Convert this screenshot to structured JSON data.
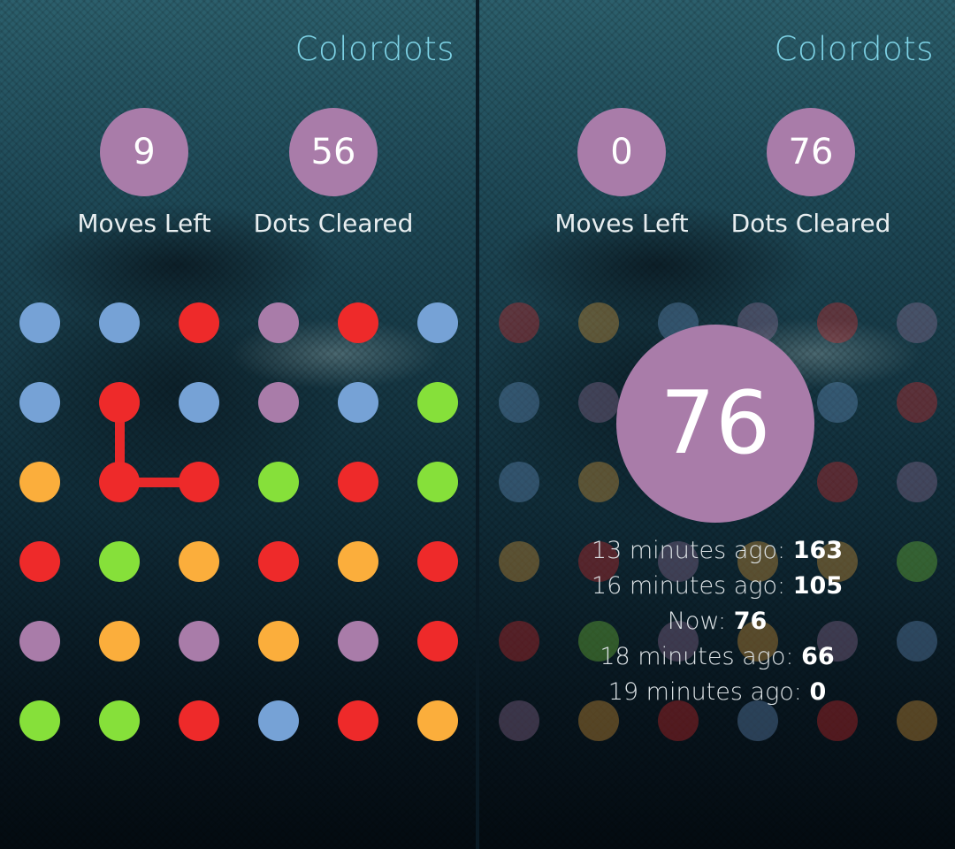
{
  "app_title": "Colordots",
  "colors": {
    "blue": "#76a2d6",
    "red": "#ee2a2a",
    "purple": "#a97ca9",
    "green": "#86e03a",
    "orange": "#fbae3c",
    "accent": "#7fd3e6"
  },
  "left_screen": {
    "moves_left": "9",
    "moves_left_label": "Moves Left",
    "dots_cleared": "56",
    "dots_cleared_label": "Dots Cleared",
    "grid": [
      [
        "blue",
        "blue",
        "red",
        "purple",
        "red",
        "blue"
      ],
      [
        "blue",
        "red",
        "blue",
        "purple",
        "blue",
        "green"
      ],
      [
        "orange",
        "red",
        "red",
        "green",
        "red",
        "green"
      ],
      [
        "red",
        "green",
        "orange",
        "red",
        "orange",
        "red"
      ],
      [
        "purple",
        "orange",
        "purple",
        "orange",
        "purple",
        "red"
      ],
      [
        "green",
        "green",
        "red",
        "blue",
        "red",
        "orange"
      ]
    ],
    "selection_path": [
      [
        1,
        1
      ],
      [
        2,
        1
      ],
      [
        2,
        2
      ]
    ]
  },
  "right_screen": {
    "moves_left": "0",
    "moves_left_label": "Moves Left",
    "dots_cleared": "76",
    "dots_cleared_label": "Dots Cleared",
    "final_score": "76",
    "grid": [
      [
        "red",
        "orange",
        "blue",
        "purple",
        "red",
        "purple"
      ],
      [
        "blue",
        "purple",
        "blue",
        "purple",
        "blue",
        "red"
      ],
      [
        "blue",
        "orange",
        "red",
        "blue",
        "red",
        "purple"
      ],
      [
        "orange",
        "red",
        "purple",
        "orange",
        "orange",
        "green"
      ],
      [
        "red",
        "green",
        "purple",
        "orange",
        "purple",
        "blue"
      ],
      [
        "purple",
        "orange",
        "red",
        "blue",
        "red",
        "orange"
      ]
    ],
    "history": [
      {
        "label": "13 minutes ago: ",
        "score": "163"
      },
      {
        "label": "16 minutes ago: ",
        "score": "105"
      },
      {
        "label": "Now: ",
        "score": "76"
      },
      {
        "label": "18 minutes ago: ",
        "score": "66"
      },
      {
        "label": "19 minutes ago: ",
        "score": "0"
      }
    ]
  }
}
